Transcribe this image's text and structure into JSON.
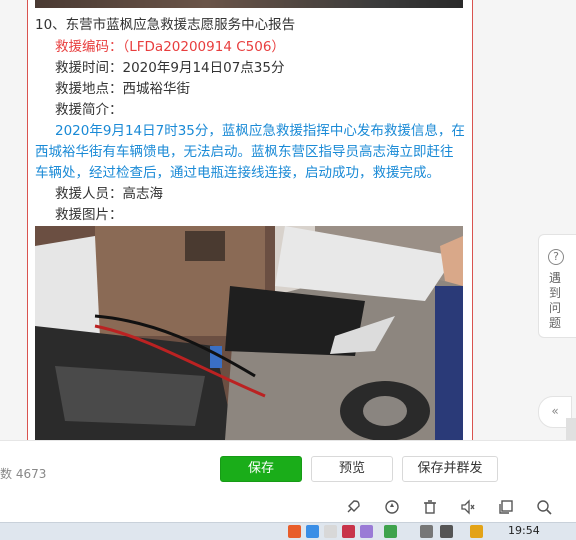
{
  "article": {
    "title": "10、东营市蓝枫应急救援志愿服务中心报告",
    "rescue_code": "救援编码：（LFDa20200914 C506）",
    "rescue_time": "救援时间：2020年9月14日07点35分",
    "rescue_location": "救援地点：西城裕华街",
    "rescue_summary_label": "救援简介：",
    "summary_lines": [
      "2020年9月14日7时35分，蓝枫应急救援指挥中心发布救援信息，在",
      "西城裕华街有车辆馈电，无法启动。蓝枫东营区指导员高志海立即赶往",
      "车辆处，经过检查后，通过电瓶连接线连接，启动成功，救援完成。"
    ],
    "rescuers": "救援人员：高志海",
    "pictures_label": "救援图片："
  },
  "side_widget": {
    "help_symbol": "?",
    "help_text": "遇到问题",
    "collapse_symbol": "«"
  },
  "action_bar": {
    "word_count": "数 4673",
    "save_label": "保存",
    "preview_label": "预览",
    "publish_label": "保存并群发"
  },
  "toolbar_icons": [
    "rocket-icon",
    "refresh-icon",
    "trash-icon",
    "speaker-icon",
    "copy-icon",
    "search-icon"
  ],
  "taskbar": {
    "time": "19:54"
  },
  "colors": {
    "accent_green": "#1aad19",
    "code_red": "#e83e3e",
    "summary_blue": "#1a8ad6",
    "card_border_red": "#d9534f"
  }
}
